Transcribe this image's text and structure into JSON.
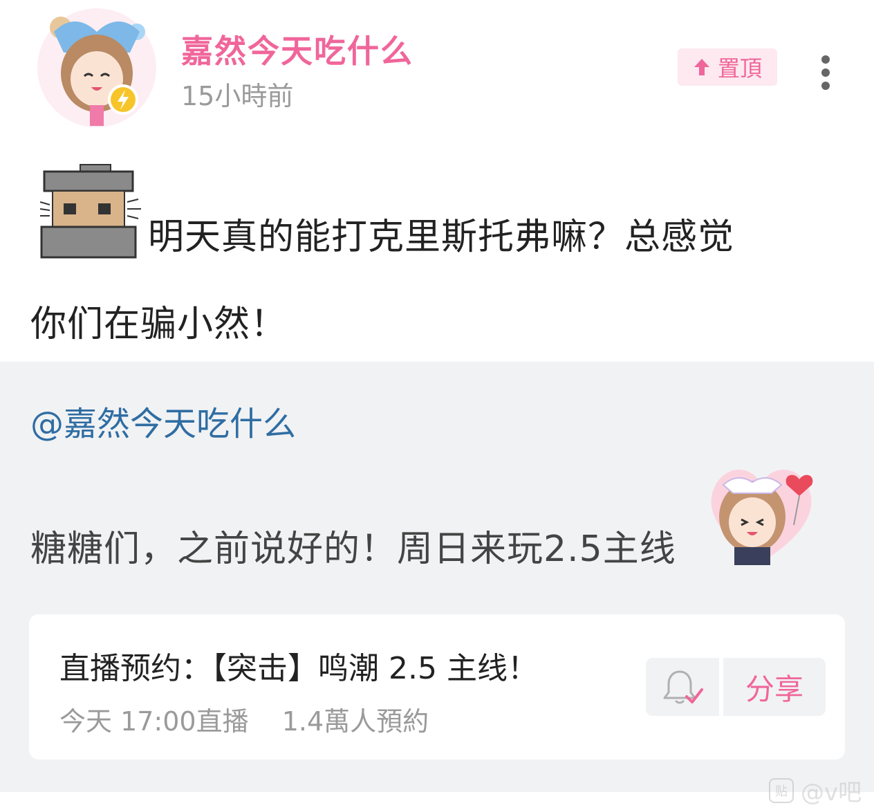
{
  "header": {
    "username": "嘉然今天吃什么",
    "time": "15小時前",
    "pin_label": "置頂"
  },
  "post": {
    "line1": "明天真的能打克里斯托弗嘛？总感觉",
    "line2": "你们在骗小然！"
  },
  "forwarded": {
    "mention": "@嘉然今天吃什么",
    "text": "糖糖们，之前说好的！周日来玩2.5主线"
  },
  "live_card": {
    "title": "直播预约：【突击】鸣潮 2.5 主线！",
    "schedule": "今天 17:00直播",
    "reservations": "1.4萬人預約",
    "share_label": "分享"
  },
  "watermark": {
    "logo": "贴",
    "text": "@v吧"
  },
  "colors": {
    "accent_pink": "#f0669a",
    "mention_blue": "#2f6da3",
    "block_bg": "#f1f2f4"
  },
  "icons": [
    "verified-lightning-icon",
    "arrow-up-icon",
    "more-vertical-icon",
    "bell-check-icon"
  ]
}
